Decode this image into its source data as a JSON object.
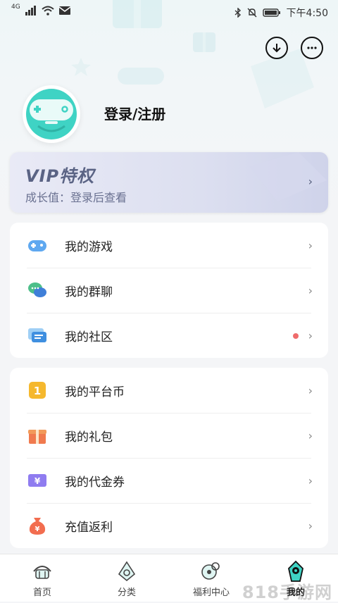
{
  "status_bar": {
    "network": "4G",
    "time": "下午4:50",
    "icons": [
      "signal-icon",
      "wifi-icon",
      "mail-icon",
      "bluetooth-icon",
      "mute-icon",
      "battery-icon"
    ]
  },
  "header": {
    "download_icon": "download-icon",
    "message_icon": "message-icon"
  },
  "profile": {
    "avatar_icon": "gamepad-avatar-icon",
    "login_label": "登录/注册"
  },
  "vip": {
    "title": "VIP特权",
    "subtitle": "成长值：登录后查看",
    "chevron": "›"
  },
  "menu_group_1": [
    {
      "label": "我的游戏",
      "icon": "gamepad-icon",
      "chevron": "›"
    },
    {
      "label": "我的群聊",
      "icon": "chat-bubbles-icon",
      "chevron": "›"
    },
    {
      "label": "我的社区",
      "icon": "community-icon",
      "chevron": "›",
      "badge": "red-dot"
    }
  ],
  "menu_group_2": [
    {
      "label": "我的平台币",
      "icon": "coin-icon",
      "chevron": "›"
    },
    {
      "label": "我的礼包",
      "icon": "gift-icon",
      "chevron": "›"
    },
    {
      "label": "我的代金券",
      "icon": "voucher-icon",
      "chevron": "›"
    },
    {
      "label": "充值返利",
      "icon": "money-bag-icon",
      "chevron": "›"
    }
  ],
  "bottom_nav": [
    {
      "label": "首页",
      "icon": "home-icon",
      "active": false
    },
    {
      "label": "分类",
      "icon": "category-icon",
      "active": false
    },
    {
      "label": "福利中心",
      "icon": "welfare-icon",
      "active": false
    },
    {
      "label": "我的",
      "icon": "profile-icon",
      "active": true
    }
  ],
  "watermark": "818手游网",
  "colors": {
    "accent_teal": "#3fd3c4",
    "vip_text": "#5a6384",
    "red_dot": "#ef6b6b"
  }
}
